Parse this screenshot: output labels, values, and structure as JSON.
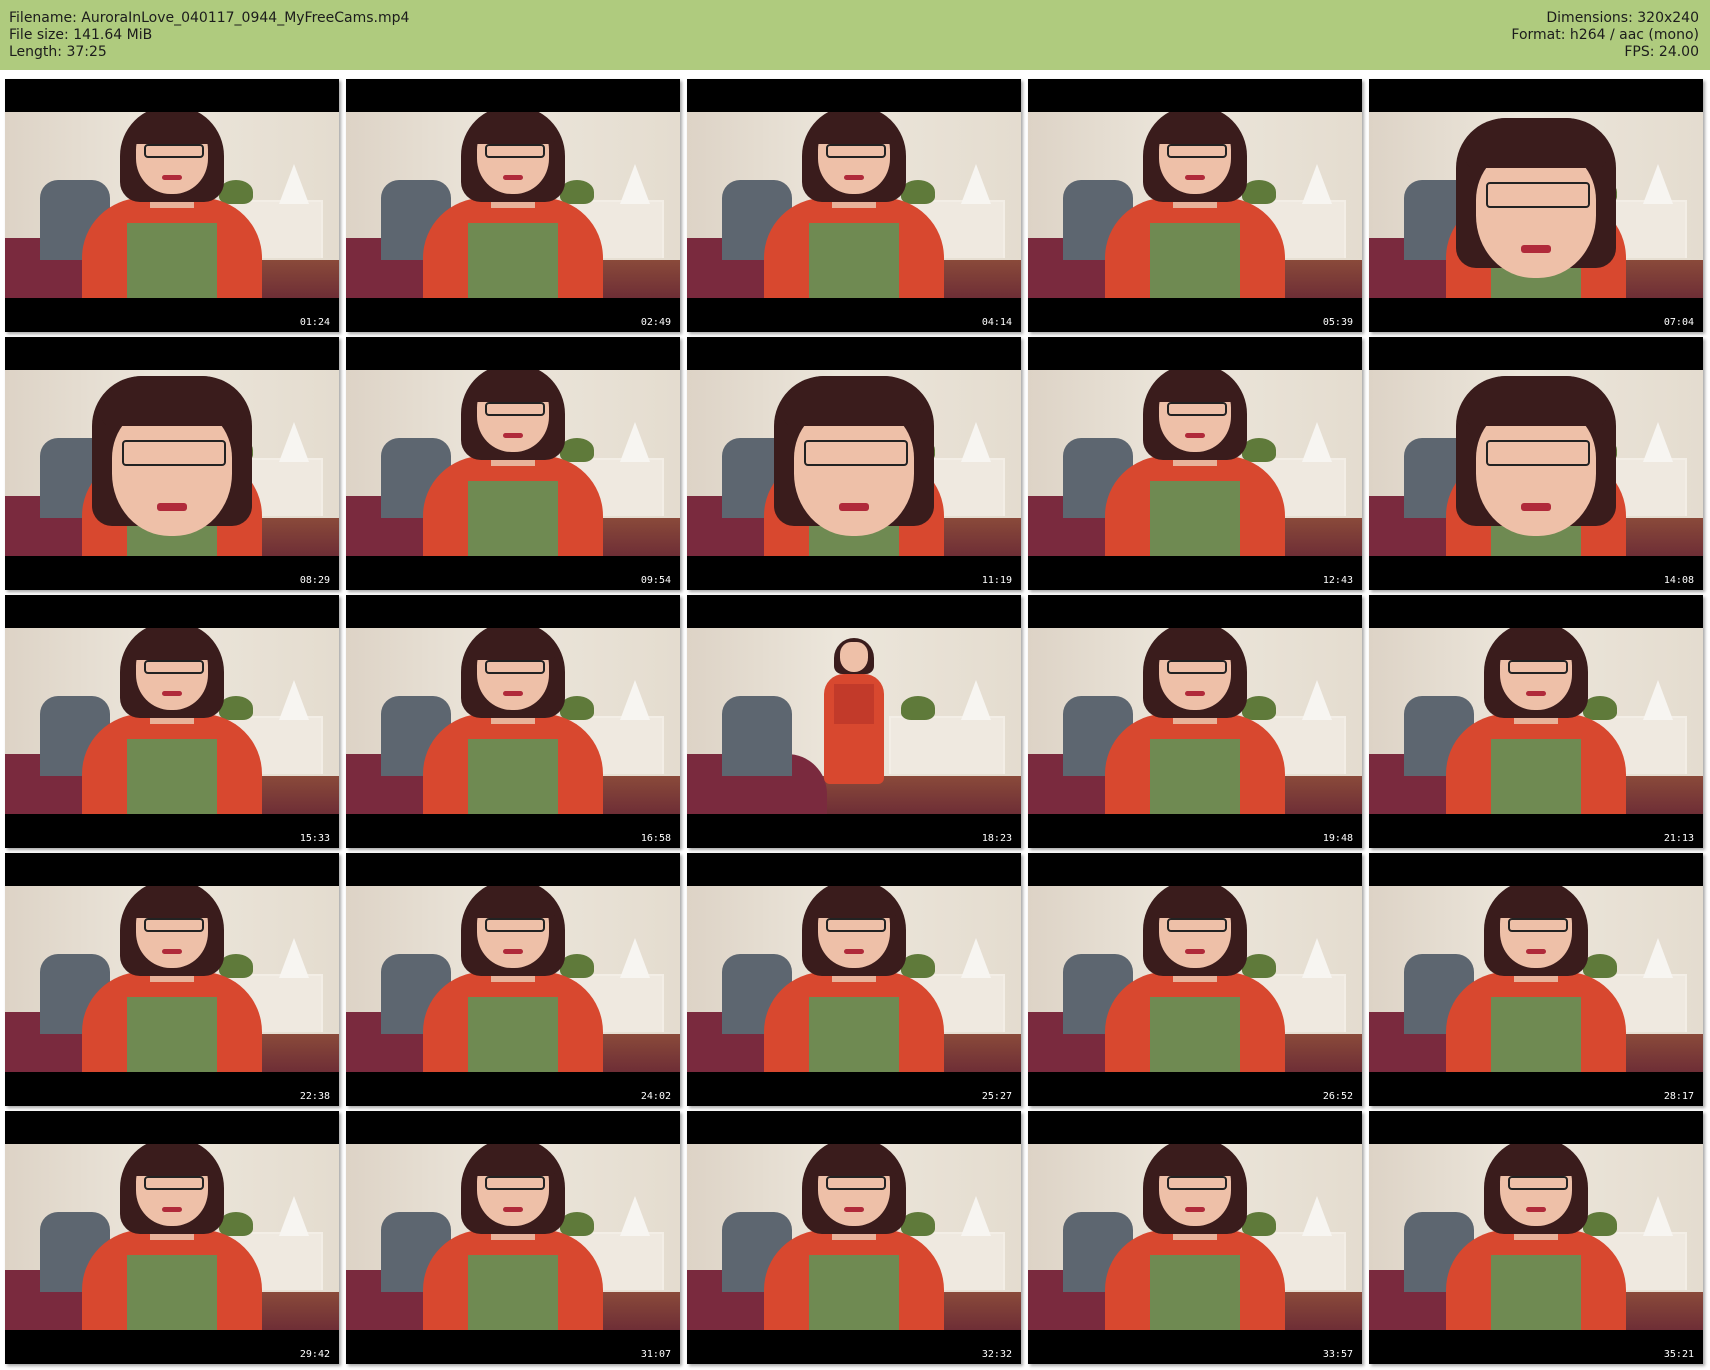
{
  "header": {
    "filename": "Filename: AuroraInLove_040117_0944_MyFreeCams.mp4",
    "file_size": "File size: 141.64 MiB",
    "length": "Length: 37:25",
    "dimensions": "Dimensions: 320x240",
    "format": "Format: h264 / aac (mono)",
    "fps": "FPS: 24.00"
  },
  "colors": {
    "header_bg": "#afcb7e",
    "thumb_bg": "#000000"
  },
  "thumbnails": [
    {
      "time": "01:24",
      "shot": "medium"
    },
    {
      "time": "02:49",
      "shot": "medium"
    },
    {
      "time": "04:14",
      "shot": "medium"
    },
    {
      "time": "05:39",
      "shot": "medium"
    },
    {
      "time": "07:04",
      "shot": "close"
    },
    {
      "time": "08:29",
      "shot": "close"
    },
    {
      "time": "09:54",
      "shot": "medium"
    },
    {
      "time": "11:19",
      "shot": "close"
    },
    {
      "time": "12:43",
      "shot": "medium"
    },
    {
      "time": "14:08",
      "shot": "close"
    },
    {
      "time": "15:33",
      "shot": "medium"
    },
    {
      "time": "16:58",
      "shot": "medium"
    },
    {
      "time": "18:23",
      "shot": "full"
    },
    {
      "time": "19:48",
      "shot": "medium"
    },
    {
      "time": "21:13",
      "shot": "medium"
    },
    {
      "time": "22:38",
      "shot": "medium"
    },
    {
      "time": "24:02",
      "shot": "medium"
    },
    {
      "time": "25:27",
      "shot": "medium"
    },
    {
      "time": "26:52",
      "shot": "medium"
    },
    {
      "time": "28:17",
      "shot": "medium"
    },
    {
      "time": "29:42",
      "shot": "medium"
    },
    {
      "time": "31:07",
      "shot": "medium"
    },
    {
      "time": "32:32",
      "shot": "medium"
    },
    {
      "time": "33:57",
      "shot": "medium"
    },
    {
      "time": "35:21",
      "shot": "medium"
    }
  ]
}
